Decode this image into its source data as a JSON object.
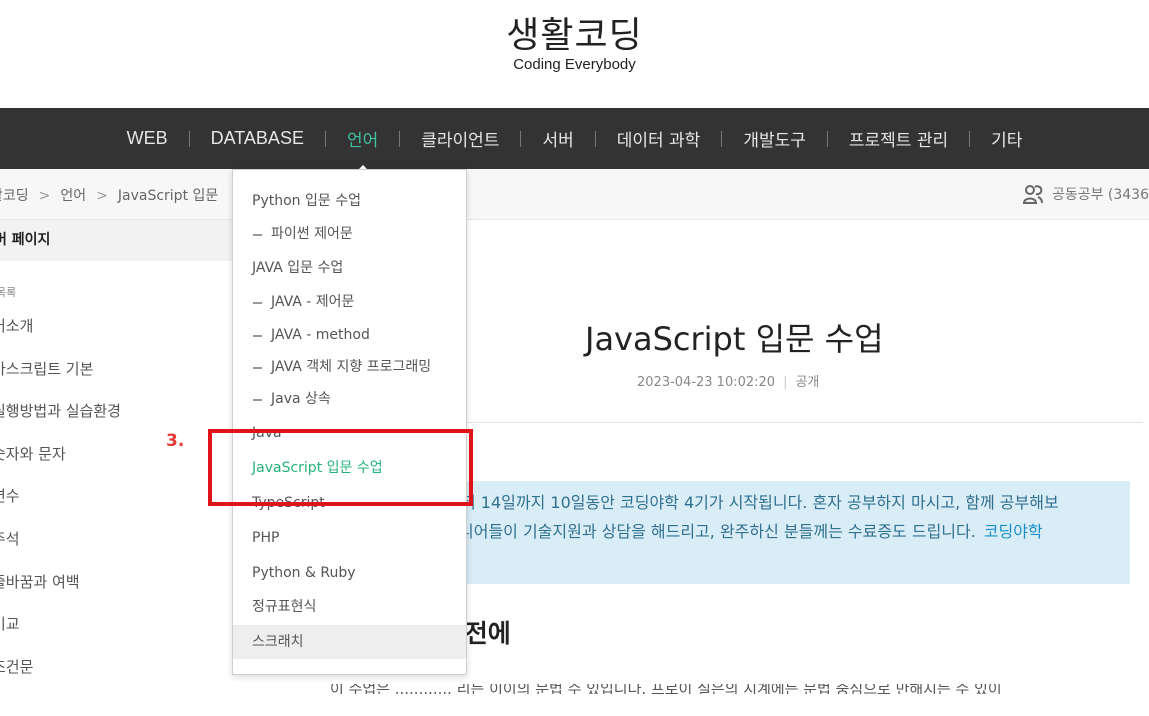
{
  "site": {
    "title": "생활코딩",
    "subtitle": "Coding Everybody"
  },
  "nav": {
    "items": [
      "WEB",
      "DATABASE",
      "언어",
      "클라이언트",
      "서버",
      "데이터 과학",
      "개발도구",
      "프로젝트 관리",
      "기타"
    ],
    "active": "언어",
    "active_color": "#3fbf9f"
  },
  "breadcrumb": {
    "items": [
      "활코딩",
      "언어",
      "JavaScript 입문"
    ],
    "separator": ">"
  },
  "study": {
    "icon": "users-icon",
    "label": "공동공부 (3436"
  },
  "sidebar": {
    "header": "버 페이지",
    "toc_label": "목록",
    "items": [
      "어소개",
      "바스크립트 기본",
      "실행방법과 실습환경",
      "숫자와 문자",
      "변수",
      "주석",
      "줄바꿈과 여백",
      "비교",
      "조건문"
    ]
  },
  "main": {
    "title": "JavaScript 입문 수업",
    "date": "2023-04-23 10:02:20",
    "visibility": "공개",
    "notice_line1": "터 14일까지 10일동안 코딩야학 4기가 시작됩니다. 혼자 공부하지 마시고, 함께 공부해보",
    "notice_line2": "니어들이 기술지원과 상담을 해드리고, 완주하신 분들께는 수료증도 드립니다.",
    "notice_link": "코딩야학",
    "section_heading": "하기 전에",
    "body_partial": "이 수업은 ............ 리는 이이의 문법 수 있입니다. 프로이 실은의 시계에는 문법 중심으로 만해지는 수 있이"
  },
  "dropdown": {
    "items": [
      {
        "label": "Python 입문 수업",
        "level": 0
      },
      {
        "label": "파이썬 제어문",
        "level": 1
      },
      {
        "label": "JAVA 입문 수업",
        "level": 0
      },
      {
        "label": "JAVA - 제어문",
        "level": 1
      },
      {
        "label": "JAVA - method",
        "level": 1
      },
      {
        "label": "JAVA 객체 지향 프로그래밍",
        "level": 1
      },
      {
        "label": "Java 상속",
        "level": 1
      },
      {
        "label": "Java",
        "level": 0
      },
      {
        "label": "JavaScript 입문 수업",
        "level": 0,
        "active": true
      },
      {
        "label": "TypeScript",
        "level": 0
      },
      {
        "label": "PHP",
        "level": 0
      },
      {
        "label": "Python & Ruby",
        "level": 0
      },
      {
        "label": "정규표현식",
        "level": 0
      },
      {
        "label": "스크래치",
        "level": 0,
        "hover": true
      }
    ],
    "active_color": "#24b37c"
  },
  "annotation": {
    "label": "3.",
    "color": "#e0131a"
  }
}
